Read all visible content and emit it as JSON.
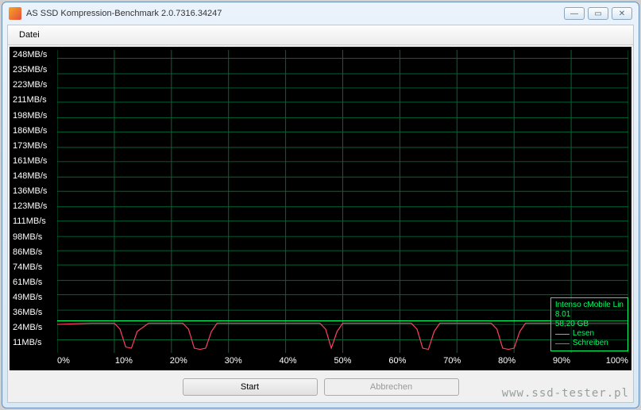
{
  "window": {
    "title": "AS SSD Kompression-Benchmark 2.0.7316.34247"
  },
  "menu": {
    "datei": "Datei"
  },
  "buttons": {
    "start": "Start",
    "abort": "Abbrechen"
  },
  "legend": {
    "device": "Intenso cMobile Lin",
    "firmware": "8.01",
    "capacity": "58,20 GB",
    "read": "Lesen",
    "write": "Schreiben"
  },
  "watermark": "www.ssd-tester.pl",
  "chart_data": {
    "type": "line",
    "xlabel": "",
    "ylabel": "",
    "x_ticks": [
      "0%",
      "10%",
      "20%",
      "30%",
      "40%",
      "50%",
      "60%",
      "70%",
      "80%",
      "90%",
      "100%"
    ],
    "y_ticks": [
      "248MB/s",
      "235MB/s",
      "223MB/s",
      "211MB/s",
      "198MB/s",
      "186MB/s",
      "173MB/s",
      "161MB/s",
      "148MB/s",
      "136MB/s",
      "123MB/s",
      "111MB/s",
      "98MB/s",
      "86MB/s",
      "74MB/s",
      "61MB/s",
      "49MB/s",
      "36MB/s",
      "24MB/s",
      "11MB/s"
    ],
    "xlim": [
      0,
      100
    ],
    "ylim": [
      0,
      255
    ],
    "series": [
      {
        "name": "Lesen",
        "color": "#00ff66",
        "x": [
          0,
          5,
          10,
          15,
          20,
          25,
          30,
          35,
          40,
          45,
          50,
          55,
          60,
          65,
          70,
          75,
          80,
          85,
          90,
          95,
          100
        ],
        "y": [
          27,
          27,
          27,
          27,
          27,
          27,
          27,
          27,
          27,
          27,
          27,
          27,
          27,
          27,
          27,
          27,
          27,
          27,
          27,
          27,
          27
        ]
      },
      {
        "name": "Schreiben",
        "color": "#ff4060",
        "x": [
          0,
          6,
          8,
          10,
          11,
          12,
          13,
          14,
          16,
          22,
          23,
          24,
          25,
          26,
          27,
          28,
          30,
          40,
          46,
          47,
          48,
          49,
          50,
          56,
          60,
          62,
          63,
          64,
          65,
          66,
          67,
          70,
          76,
          77,
          78,
          79,
          80,
          81,
          82,
          84,
          90,
          95,
          100
        ],
        "y": [
          24,
          25,
          25,
          25,
          20,
          5,
          4,
          18,
          25,
          25,
          20,
          4,
          3,
          4,
          18,
          25,
          25,
          25,
          25,
          20,
          4,
          18,
          25,
          25,
          25,
          25,
          20,
          4,
          3,
          18,
          25,
          25,
          25,
          20,
          4,
          3,
          4,
          18,
          25,
          25,
          25,
          25,
          25
        ]
      }
    ]
  }
}
